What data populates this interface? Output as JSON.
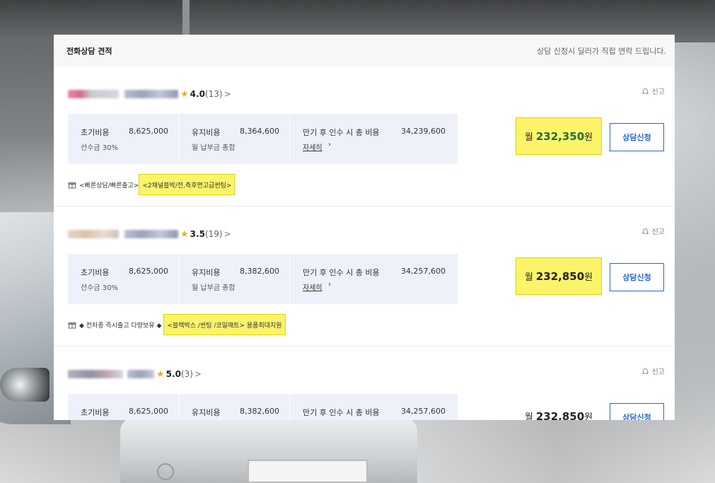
{
  "header": {
    "title": "전화상담 견적",
    "note": "상담 신청시 딜러가 직접 연락 드립니다."
  },
  "dealers": [
    {
      "rating": "4.0",
      "review_count": "(13)",
      "report_label": "신고",
      "initial_cost_label": "초기비용",
      "initial_cost_value": "8,625,000",
      "initial_cost_sub": "선수금 30%",
      "maintenance_label": "유지비용",
      "maintenance_value": "8,364,600",
      "maintenance_sub": "월 납부금 총합",
      "total_label": "만기 후 인수 시 총 비용",
      "total_value": "34,239,600",
      "details_link": "자세히",
      "price_unit": "월",
      "price_value": "232,350",
      "price_won": "원",
      "consult_button": "상담신청",
      "promo_prefix": "<빠른상담/빠른출고>",
      "promo_highlight": "<2채널블박/전,측후면고급썬팅>"
    },
    {
      "rating": "3.5",
      "review_count": "(19)",
      "report_label": "신고",
      "initial_cost_label": "초기비용",
      "initial_cost_value": "8,625,000",
      "initial_cost_sub": "선수금 30%",
      "maintenance_label": "유지비용",
      "maintenance_value": "8,382,600",
      "maintenance_sub": "월 납부금 총합",
      "total_label": "만기 후 인수 시 총 비용",
      "total_value": "34,257,600",
      "details_link": "자세히",
      "price_unit": "월",
      "price_value": "232,850",
      "price_won": "원",
      "consult_button": "상담신청",
      "promo_prefix": "◆ 전차종 즉시출고 다량보유 ◆",
      "promo_highlight": "<블랙박스 /썬팅 /코일매트> 용품최대지원"
    },
    {
      "rating": "5.0",
      "review_count": "(3)",
      "report_label": "신고",
      "initial_cost_label": "초기비용",
      "initial_cost_value": "8,625,000",
      "maintenance_label": "유지비용",
      "maintenance_value": "8,382,600",
      "total_label": "만기 후 인수 시 총 비용",
      "total_value": "34,257,600",
      "price_unit": "월",
      "price_value": "232,850",
      "price_won": "원",
      "consult_button": "상담신청"
    }
  ],
  "colors": {
    "accent_blue": "#2a66d9",
    "highlight_yellow": "#fbf46a",
    "star": "#f1b200",
    "cost_box_bg": "#eef1fa",
    "price_green": "#1f6b43"
  }
}
